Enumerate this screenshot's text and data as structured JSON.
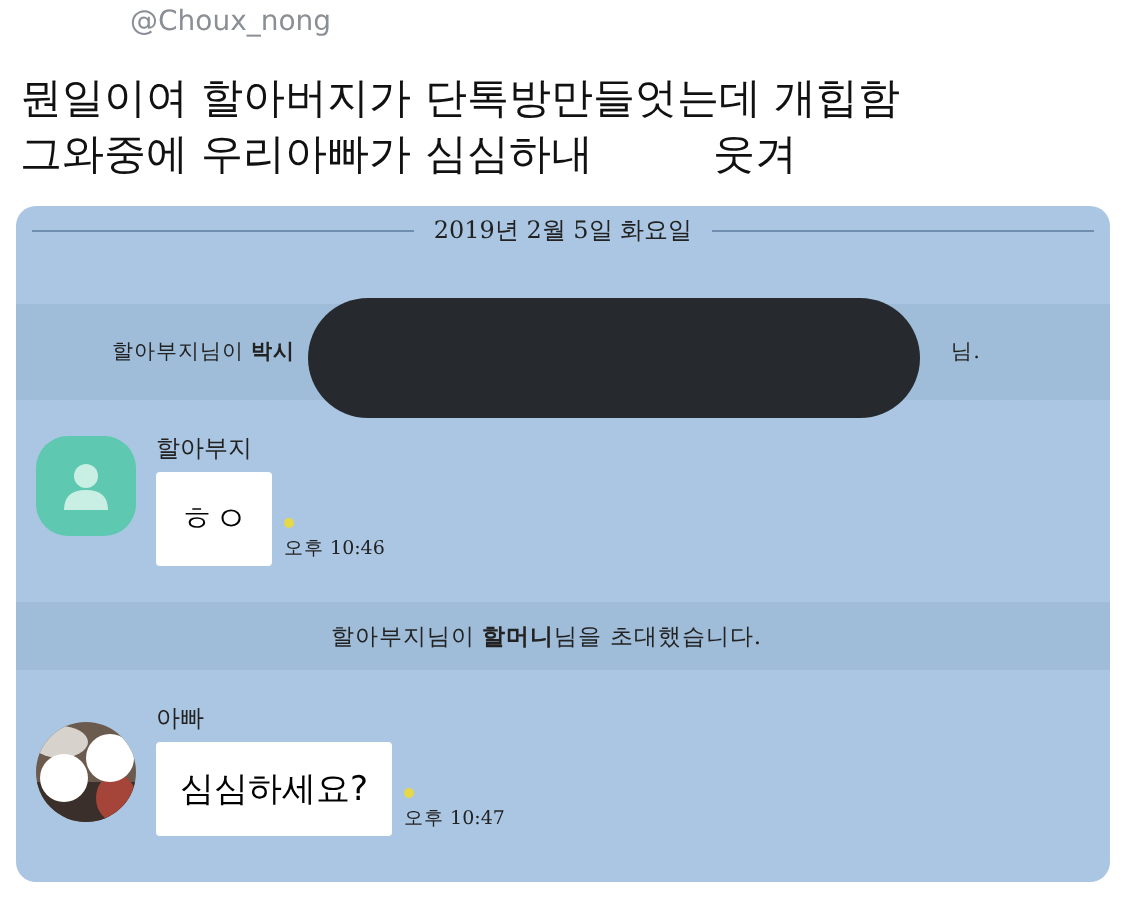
{
  "tweet": {
    "handle": "@Choux_nong",
    "lines": [
      [
        "뭔일이여 할아버지가 단톡방만들엇는데 개힙함"
      ],
      [
        "그와중에 우리아빠가 심심하내",
        "웃겨"
      ]
    ]
  },
  "chat": {
    "date": "2019년 2월 5일 화요일",
    "items": [
      {
        "kind": "system",
        "text": "할아부지님이 **박시**",
        "tail": "님.",
        "redacted": true
      },
      {
        "kind": "message",
        "sender": "할아부지",
        "avatar": {
          "kind": "default"
        },
        "text": "ㅎㅇ",
        "unread": true,
        "time": "오후 10:46"
      },
      {
        "kind": "system",
        "text": "할아부지님이 **할머니**님을 초대했습니다.",
        "redacted": false
      },
      {
        "kind": "message",
        "sender": "아빠",
        "text": "심심하세요?",
        "unread": true,
        "time": "오후 10:47"
      }
    ]
  }
}
